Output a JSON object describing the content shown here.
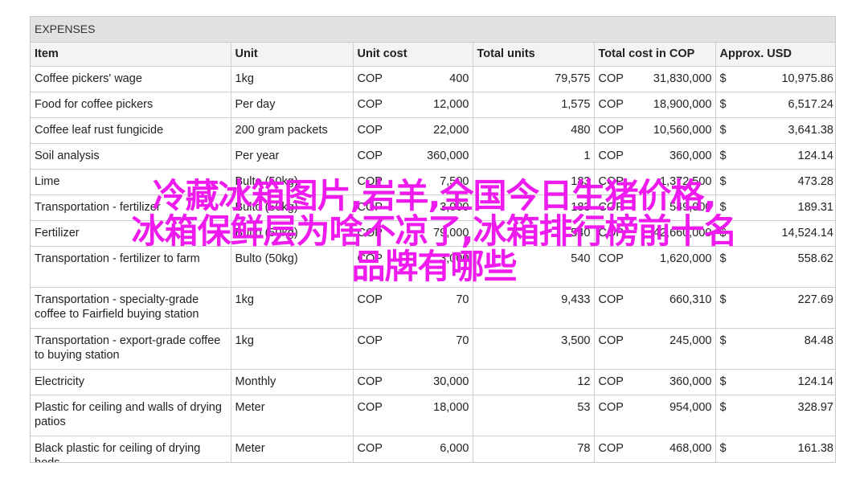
{
  "sheet": {
    "title": "EXPENSES"
  },
  "table": {
    "headers": [
      "Item",
      "Unit",
      "Unit cost",
      "Total units",
      "Total cost in COP",
      "Approx. USD"
    ],
    "rows": [
      {
        "item": "Coffee pickers' wage",
        "unit": "1kg",
        "currency": "COP",
        "unit_cost": "400",
        "total_units": "79,575",
        "total_currency": "COP",
        "total_cost": "31,830,000",
        "usd_symbol": "$",
        "usd": "10,975.86"
      },
      {
        "item": "Food for coffee pickers",
        "unit": "Per day",
        "currency": "COP",
        "unit_cost": "12,000",
        "total_units": "1,575",
        "total_currency": "COP",
        "total_cost": "18,900,000",
        "usd_symbol": "$",
        "usd": "6,517.24"
      },
      {
        "item": "Coffee leaf rust fungicide",
        "unit": "200 gram packets",
        "currency": "COP",
        "unit_cost": "22,000",
        "total_units": "480",
        "total_currency": "COP",
        "total_cost": "10,560,000",
        "usd_symbol": "$",
        "usd": "3,641.38"
      },
      {
        "item": "Soil analysis",
        "unit": "Per year",
        "currency": "COP",
        "unit_cost": "360,000",
        "total_units": "1",
        "total_currency": "COP",
        "total_cost": "360,000",
        "usd_symbol": "$",
        "usd": "124.14"
      },
      {
        "item": "Lime",
        "unit": "Bulto (50kg)",
        "currency": "COP",
        "unit_cost": "7,500",
        "total_units": "183",
        "total_currency": "COP",
        "total_cost": "1,372,500",
        "usd_symbol": "$",
        "usd": "473.28"
      },
      {
        "item": "Transportation - fertilizer",
        "unit": "Bulto (50kg)",
        "currency": "COP",
        "unit_cost": "3,000",
        "total_units": "183",
        "total_currency": "COP",
        "total_cost": "549,000",
        "usd_symbol": "$",
        "usd": "189.31"
      },
      {
        "item": "Fertilizer",
        "unit": "Bulto (50kg)",
        "currency": "COP",
        "unit_cost": "79,000",
        "total_units": "540",
        "total_currency": "COP",
        "total_cost": "42,660,000",
        "usd_symbol": "$",
        "usd": "14,524.14"
      },
      {
        "item": "Transportation - fertilizer to farm",
        "unit": "Bulto (50kg)",
        "currency": "COP",
        "unit_cost": "3,000",
        "total_units": "540",
        "total_currency": "COP",
        "total_cost": "1,620,000",
        "usd_symbol": "$",
        "usd": "558.62"
      },
      {
        "item": "Transportation - specialty-grade coffee to Fairfield buying station",
        "unit": "1kg",
        "currency": "COP",
        "unit_cost": "70",
        "total_units": "9,433",
        "total_currency": "COP",
        "total_cost": "660,310",
        "usd_symbol": "$",
        "usd": "227.69"
      },
      {
        "item": "Transportation - export-grade coffee to buying station",
        "unit": "1kg",
        "currency": "COP",
        "unit_cost": "70",
        "total_units": "3,500",
        "total_currency": "COP",
        "total_cost": "245,000",
        "usd_symbol": "$",
        "usd": "84.48"
      },
      {
        "item": "Electricity",
        "unit": "Monthly",
        "currency": "COP",
        "unit_cost": "30,000",
        "total_units": "12",
        "total_currency": "COP",
        "total_cost": "360,000",
        "usd_symbol": "$",
        "usd": "124.14"
      },
      {
        "item": "Plastic for ceiling and walls of drying patios",
        "unit": "Meter",
        "currency": "COP",
        "unit_cost": "18,000",
        "total_units": "53",
        "total_currency": "COP",
        "total_cost": "954,000",
        "usd_symbol": "$",
        "usd": "328.97"
      },
      {
        "item": "Black plastic for ceiling of drying beds",
        "unit": "Meter",
        "currency": "COP",
        "unit_cost": "6,000",
        "total_units": "78",
        "total_currency": "COP",
        "total_cost": "468,000",
        "usd_symbol": "$",
        "usd": "161.38"
      }
    ]
  },
  "overlay": {
    "line1": "冷藏冰箱图片,岩羊,全国今日生猪价格,",
    "line2": "冰箱保鲜层为啥不凉了,冰箱排行榜前十名",
    "line3": "品牌有哪些",
    "color": "#ee1aee"
  }
}
